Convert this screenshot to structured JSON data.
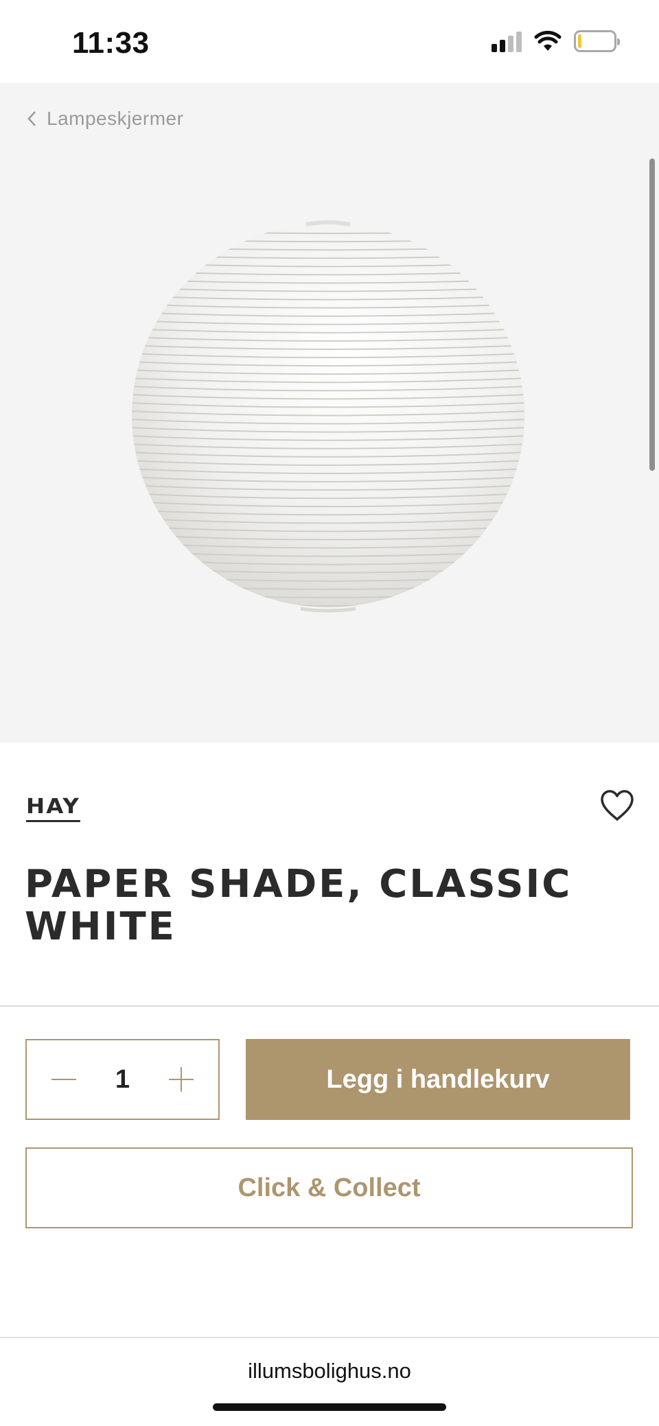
{
  "status_bar": {
    "time": "11:33",
    "icons": [
      "cellular-signal-icon",
      "wifi-icon",
      "battery-icon"
    ],
    "battery_level": 0.1
  },
  "breadcrumb": {
    "label": "Lampeskjermer",
    "icon": "chevron-left-icon"
  },
  "product": {
    "brand": "HAY",
    "title": "PAPER SHADE, CLASSIC WHITE",
    "image": "round white paper lantern shade",
    "favorite_icon": "heart-icon"
  },
  "purchase": {
    "quantity": "1",
    "decrement_icon": "minus-icon",
    "increment_icon": "plus-icon",
    "add_to_cart_label": "Legg i handlekurv",
    "click_collect_label": "Click & Collect"
  },
  "browser": {
    "url": "illumsbolighus.no"
  },
  "colors": {
    "accent": "#ad956e",
    "text": "#2b2b2b",
    "hero_background": "#f4f4f4"
  }
}
